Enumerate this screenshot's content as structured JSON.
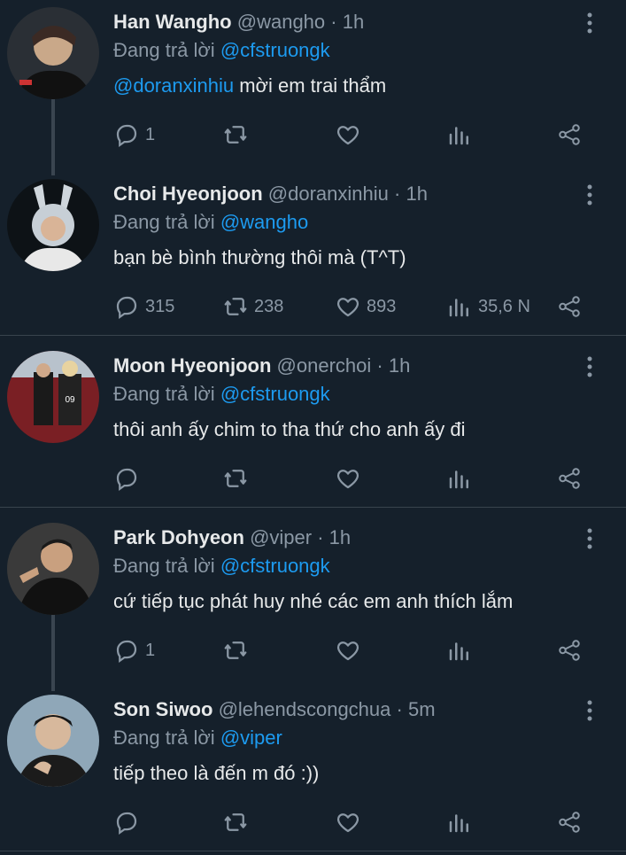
{
  "colors": {
    "background": "#15202b",
    "mention": "#1d9bf0",
    "muted": "#8b98a5",
    "text": "#e7e9ea"
  },
  "icons": {
    "more": "more-vertical-icon",
    "reply": "reply-icon",
    "retweet": "retweet-icon",
    "like": "heart-icon",
    "views": "views-chart-icon",
    "share": "share-icon"
  },
  "tweets": [
    {
      "name": "Han Wangho",
      "handle": "@wangho",
      "dot": "·",
      "time": "1h",
      "replying_prefix": "Đang trả lời",
      "replying_to": "@cfstruongk",
      "body_mention": "@doranxinhiu",
      "body_text": " mời em trai thẩm",
      "reply_count": "1",
      "retweet_count": "",
      "like_count": "",
      "view_count": ""
    },
    {
      "name": "Choi Hyeonjoon",
      "handle": "@doranxinhiu",
      "dot": "·",
      "time": "1h",
      "replying_prefix": "Đang trả lời",
      "replying_to": "@wangho",
      "body_mention": "",
      "body_text": "bạn bè bình thường thôi mà (T^T)",
      "reply_count": "315",
      "retweet_count": "238",
      "like_count": "893",
      "view_count": "35,6 N"
    },
    {
      "name": "Moon Hyeonjoon",
      "handle": "@onerchoi",
      "dot": "·",
      "time": "1h",
      "replying_prefix": "Đang trả lời",
      "replying_to": "@cfstruongk",
      "body_mention": "",
      "body_text": "thôi anh ấy chim to tha thứ cho anh ấy đi",
      "reply_count": "",
      "retweet_count": "",
      "like_count": "",
      "view_count": ""
    },
    {
      "name": "Park Dohyeon",
      "handle": "@viper",
      "dot": "·",
      "time": "1h",
      "replying_prefix": "Đang trả lời",
      "replying_to": "@cfstruongk",
      "body_mention": "",
      "body_text": "cứ tiếp tục phát huy nhé các em anh thích lắm",
      "reply_count": "1",
      "retweet_count": "",
      "like_count": "",
      "view_count": ""
    },
    {
      "name": "Son Siwoo",
      "handle": "@lehendscongchua",
      "dot": "·",
      "time": "5m",
      "replying_prefix": "Đang trả lời",
      "replying_to": "@viper",
      "body_mention": "",
      "body_text": "tiếp theo là đến m đó :))",
      "reply_count": "",
      "retweet_count": "",
      "like_count": "",
      "view_count": ""
    }
  ]
}
